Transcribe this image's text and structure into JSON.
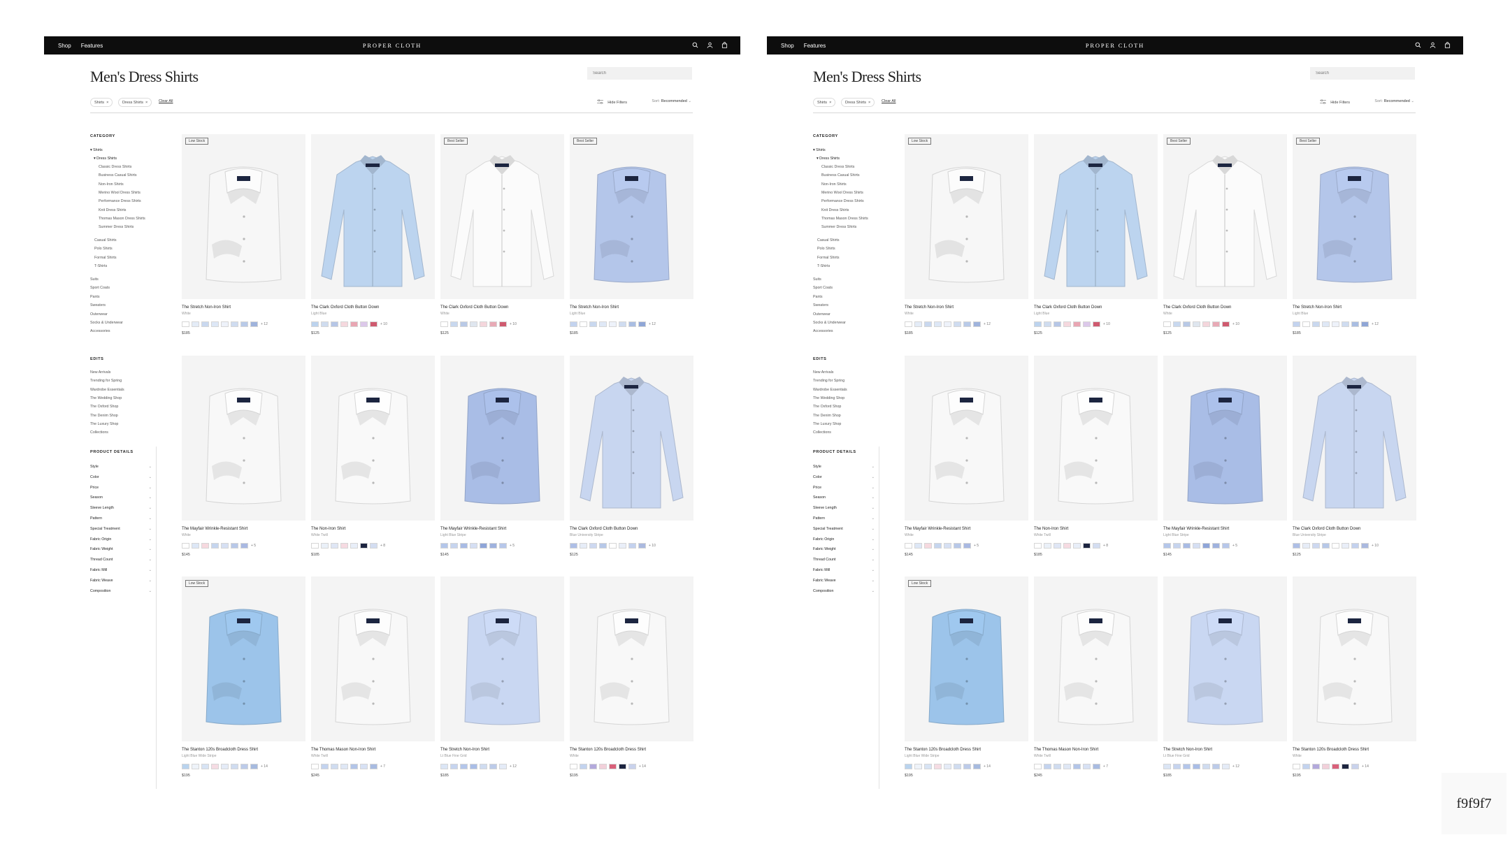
{
  "nav": {
    "shop": "Shop",
    "features": "Features",
    "brand": "PROPER CLOTH"
  },
  "page_title": "Men's Dress Shirts",
  "search_placeholder": "Search",
  "filters": {
    "chips": [
      "Shirts",
      "Dress Shirts"
    ],
    "chip_remove": "×",
    "clear_all": "Clear All",
    "hide_filters": "Hide Filters",
    "sort_label": "Sort:",
    "sort_value": "Recommended"
  },
  "sidebar": {
    "category_heading": "CATEGORY",
    "shirts": "Shirts",
    "dress_shirts": "Dress Shirts",
    "dress_sub": [
      "Classic Dress Shirts",
      "Business Casual Shirts",
      "Non-Iron Shirts",
      "Merino Wool Dress Shirts",
      "Performance Dress Shirts",
      "Knit Dress Shirts",
      "Thomas Mason Dress Shirts",
      "Summer Dress Shirts"
    ],
    "shirt_types": [
      "Casual Shirts",
      "Polo Shirts",
      "Formal Shirts",
      "T-Shirts"
    ],
    "other_categories": [
      "Suits",
      "Sport Coats",
      "Pants",
      "Sweaters",
      "Outerwear",
      "Socks & Underwear",
      "Accessories"
    ],
    "edits_heading": "EDITS",
    "edits": [
      "New Arrivals",
      "Trending for Spring",
      "Wardrobe Essentials",
      "The Wedding Shop",
      "The Oxford Shop",
      "The Denim Shop",
      "The Luxury Shop",
      "Collections"
    ],
    "details_heading": "PRODUCT DETAILS",
    "details": [
      "Style",
      "Color",
      "Price",
      "Season",
      "Sleeve Length",
      "Pattern",
      "Special Treatment",
      "Fabric Origin",
      "Fabric Weight",
      "Thread Count",
      "Fabric Mill",
      "Fabric Weave",
      "Composition"
    ]
  },
  "products": [
    {
      "name": "The Stretch Non-Iron Shirt",
      "color": "White",
      "price": "$185",
      "badge": "Low Stock",
      "more": "+ 12",
      "shirt_color": "#f7f7f7",
      "style": "folded",
      "swatches": [
        "#ffffff",
        "#e4ecf7",
        "#c9d8ef",
        "#dde7f6",
        "#eef2fa",
        "#cfdcf0",
        "#b9cae8",
        "#9fb3dc"
      ]
    },
    {
      "name": "The Clark Oxford Cloth Button Down",
      "color": "Light Blue",
      "price": "$125",
      "badge": "",
      "more": "+ 10",
      "shirt_color": "#bcd4ef",
      "style": "hanging",
      "swatches": [
        "#bcd3ee",
        "#cfdcef",
        "#b6c6e6",
        "#f5d8de",
        "#e9a6b3",
        "#dcc8ea",
        "#cf5a6f"
      ]
    },
    {
      "name": "The Clark Oxford Cloth Button Down",
      "color": "White",
      "price": "$125",
      "badge": "Best Seller",
      "more": "+ 10",
      "shirt_color": "#fbfbfb",
      "style": "hanging",
      "swatches": [
        "#ffffff",
        "#c8d8ef",
        "#b9c9e6",
        "#dfe6ef",
        "#f4d6dc",
        "#e8aab6",
        "#cf5a6f"
      ]
    },
    {
      "name": "The Stretch Non-Iron Shirt",
      "color": "Light Blue",
      "price": "$185",
      "badge": "Best Seller",
      "more": "+ 12",
      "shirt_color": "#b4c6ea",
      "style": "folded",
      "swatches": [
        "#c3d3ef",
        "#ffffff",
        "#c9d8ef",
        "#dfe8f6",
        "#eef2fa",
        "#cfdcf0",
        "#a9bde2",
        "#8fa6d6"
      ]
    },
    {
      "name": "The Mayfair Wrinkle-Resistant Shirt",
      "color": "White",
      "price": "$145",
      "badge": "",
      "more": "+ 5",
      "shirt_color": "#f8f8f8",
      "style": "folded",
      "swatches": [
        "#ffffff",
        "#dde7f6",
        "#f6d9df",
        "#c5d5ee",
        "#d6e0f3",
        "#b8c8e8",
        "#a9b9e2"
      ]
    },
    {
      "name": "The Non-Iron Shirt",
      "color": "White Twill",
      "price": "$185",
      "badge": "",
      "more": "+ 8",
      "shirt_color": "#f9f9f9",
      "style": "folded",
      "swatches": [
        "#ffffff",
        "#eaf0f8",
        "#dfe6f5",
        "#f6dbe2",
        "#e8eef8",
        "#1d2540",
        "#d3ddf1"
      ]
    },
    {
      "name": "The Mayfair Wrinkle-Resistant Shirt",
      "color": "Light Blue Stripe",
      "price": "$145",
      "badge": "",
      "more": "+ 5",
      "shirt_color": "#a9bde6",
      "style": "folded",
      "swatches": [
        "#b4c6ea",
        "#c6d4ee",
        "#a8bbe4",
        "#d5dff3",
        "#8fa5d8",
        "#9fb2de",
        "#b7c7ea"
      ]
    },
    {
      "name": "The Clark Oxford Cloth Button Down",
      "color": "Blue University Stripe",
      "price": "$125",
      "badge": "",
      "more": "+ 10",
      "shirt_color": "#c8d6f0",
      "style": "hanging",
      "swatches": [
        "#aebfe6",
        "#e6ecf7",
        "#cdd8f0",
        "#b7c8e8",
        "#ffffff",
        "#e9eef8",
        "#c3d1ee",
        "#aab9df"
      ]
    },
    {
      "name": "The Stanton 120s Broadcloth Dress Shirt",
      "color": "Light Blue Wide Stripe",
      "price": "$195",
      "badge": "Low Stock",
      "more": "+ 14",
      "shirt_color": "#9cc4ea",
      "style": "folded",
      "swatches": [
        "#b9d3ee",
        "#eef3f9",
        "#d7e3f4",
        "#f5dce3",
        "#e4ebf7",
        "#cfdcf0",
        "#bccbe9",
        "#a6badf"
      ]
    },
    {
      "name": "The Thomas Mason Non-Iron Shirt",
      "color": "White Twill",
      "price": "$245",
      "badge": "",
      "more": "+ 7",
      "shirt_color": "#f8f8f8",
      "style": "folded",
      "swatches": [
        "#ffffff",
        "#c3d3ef",
        "#cfdcf0",
        "#dfe7f5",
        "#b3c5e8",
        "#d7e1f4",
        "#a8bbe1"
      ]
    },
    {
      "name": "The Stretch Non-Iron Shirt",
      "color": "Lt Blue Fine Grid",
      "price": "$185",
      "badge": "",
      "more": "+ 12",
      "shirt_color": "#c9d7f2",
      "style": "folded",
      "swatches": [
        "#dbe5f5",
        "#c6d4ef",
        "#b4c6ea",
        "#a9bde6",
        "#cfdcf0",
        "#bccbe9",
        "#e4ebf7"
      ]
    },
    {
      "name": "The Stanton 120s Broadcloth Dress Shirt",
      "color": "White",
      "price": "$195",
      "badge": "",
      "more": "+ 14",
      "shirt_color": "#f8f8f8",
      "style": "folded",
      "swatches": [
        "#ffffff",
        "#c3d3ef",
        "#b3a9dc",
        "#f2d0da",
        "#d9607a",
        "#1d2540",
        "#c9d2ec"
      ]
    }
  ],
  "corner_label": "f9f9f7"
}
